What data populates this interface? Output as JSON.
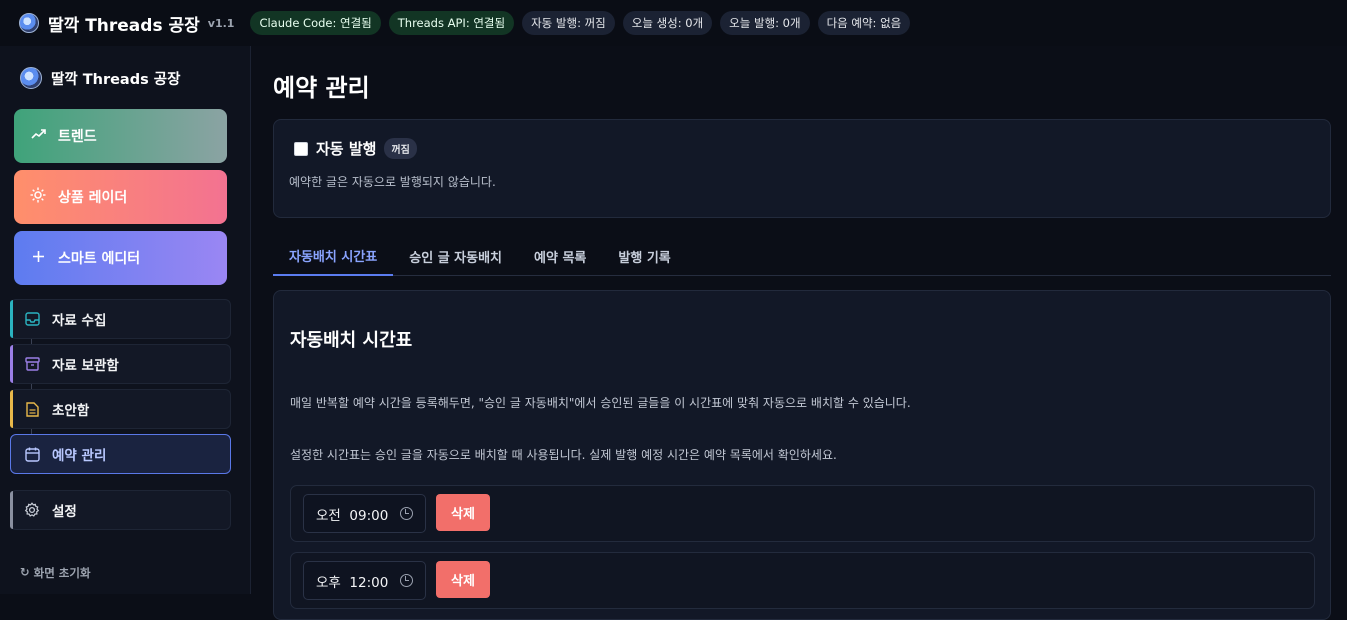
{
  "header": {
    "title": "딸깍 Threads 공장",
    "version": "v1.1",
    "chips": [
      {
        "label": "Claude Code: 연결됨",
        "status": "ok"
      },
      {
        "label": "Threads API: 연결됨",
        "status": "ok"
      },
      {
        "label": "자동 발행: 꺼짐",
        "status": "neutral"
      },
      {
        "label": "오늘 생성: 0개",
        "status": "neutral"
      },
      {
        "label": "오늘 발행: 0개",
        "status": "neutral"
      },
      {
        "label": "다음 예약: 없음",
        "status": "neutral"
      }
    ]
  },
  "sidebar": {
    "brand": "딸깍 Threads 공장",
    "big_buttons": [
      {
        "label": "트렌드",
        "icon": "trending-up-icon",
        "color": "#3fa37a"
      },
      {
        "label": "상품 레이더",
        "icon": "sun-icon",
        "color": "#ff8f6b"
      },
      {
        "label": "스마트 에디터",
        "icon": "plus-icon",
        "color": "#5d7cf0"
      }
    ],
    "items": [
      {
        "label": "자료 수집",
        "icon": "inbox-icon",
        "accent": "#2bb3c0"
      },
      {
        "label": "자료 보관함",
        "icon": "archive-icon",
        "accent": "#9b7fe6"
      },
      {
        "label": "초안함",
        "icon": "document-icon",
        "accent": "#e8b84a"
      },
      {
        "label": "예약 관리",
        "icon": "calendar-icon",
        "accent": "#5a78e8",
        "active": true
      },
      {
        "label": "설정",
        "icon": "gear-icon",
        "accent": "#8a90a0"
      }
    ],
    "reset_label": "화면 초기화",
    "reset_icon": "↻"
  },
  "main": {
    "page_title": "예약 관리",
    "auto_publish": {
      "label": "자동 발행",
      "badge": "꺼짐",
      "checked": false,
      "description": "예약한 글은 자동으로 발행되지 않습니다."
    },
    "tabs": [
      {
        "label": "자동배치 시간표",
        "active": true
      },
      {
        "label": "승인 글 자동배치"
      },
      {
        "label": "예약 목록"
      },
      {
        "label": "발행 기록"
      }
    ],
    "schedule": {
      "title": "자동배치 시간표",
      "info_1": "매일 반복할 예약 시간을 등록해두면, \"승인 글 자동배치\"에서 승인된 글들을 이 시간표에 맞춰 자동으로 배치할 수 있습니다.",
      "info_2": "설정한 시간표는 승인 글을 자동으로 배치할 때 사용됩니다. 실제 발행 예정 시간은 예약 목록에서 확인하세요.",
      "slots": [
        {
          "time": "오전  09:00",
          "delete_label": "삭제"
        },
        {
          "time": "오후  12:00",
          "delete_label": "삭제"
        }
      ]
    }
  }
}
